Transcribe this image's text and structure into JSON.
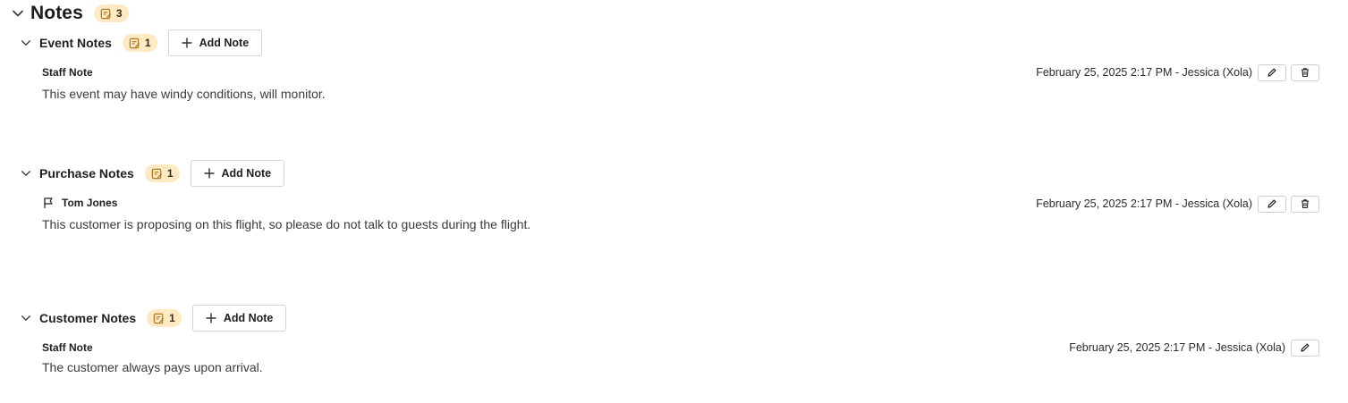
{
  "notes_panel": {
    "title": "Notes",
    "total_count": "3",
    "sections": [
      {
        "title": "Event Notes",
        "count": "1",
        "add_label": "Add Note",
        "note": {
          "author": "Staff Note",
          "flag": false,
          "text": "This event may have windy conditions, will monitor.",
          "meta": "February 25, 2025 2:17 PM - Jessica (Xola)",
          "can_delete": true
        }
      },
      {
        "title": "Purchase Notes",
        "count": "1",
        "add_label": "Add Note",
        "note": {
          "author": "Tom Jones",
          "flag": true,
          "text": "This customer is proposing on this flight, so please do not talk to guests during the flight.",
          "meta": "February 25, 2025 2:17 PM - Jessica (Xola)",
          "can_delete": true
        }
      },
      {
        "title": "Customer Notes",
        "count": "1",
        "add_label": "Add Note",
        "note": {
          "author": "Staff Note",
          "flag": false,
          "text": "The customer always pays upon arrival.",
          "meta": "February 25, 2025 2:17 PM - Jessica (Xola)",
          "can_delete": false
        }
      }
    ]
  },
  "icons": {
    "collapse": "chevron-down-icon",
    "notes": "notes-icon",
    "add": "plus-icon",
    "flag": "flag-icon",
    "edit": "pencil-icon",
    "delete": "trash-icon"
  },
  "colors": {
    "badge_bg": "#fde9c4",
    "badge_icon": "#b07a1e"
  }
}
